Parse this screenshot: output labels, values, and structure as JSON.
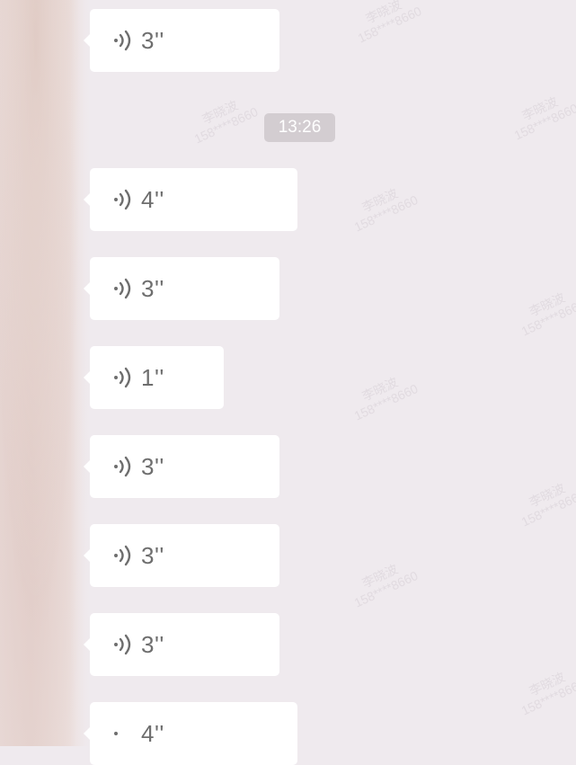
{
  "chat": {
    "timestamp": "13:26",
    "voice_messages": [
      {
        "duration": "3''"
      },
      {
        "duration": "4''"
      },
      {
        "duration": "3''"
      },
      {
        "duration": "1''"
      },
      {
        "duration": "3''"
      },
      {
        "duration": "3''"
      },
      {
        "duration": "3''"
      },
      {
        "duration": "4''"
      }
    ]
  },
  "watermark": {
    "name": "李晓波",
    "phone": "158****8660"
  },
  "colors": {
    "background": "#efeaee",
    "bubble": "#ffffff",
    "time_badge": "#d3cdd1",
    "text": "#6e6e6e"
  },
  "icons": {
    "voice": "voice-wave-icon"
  }
}
